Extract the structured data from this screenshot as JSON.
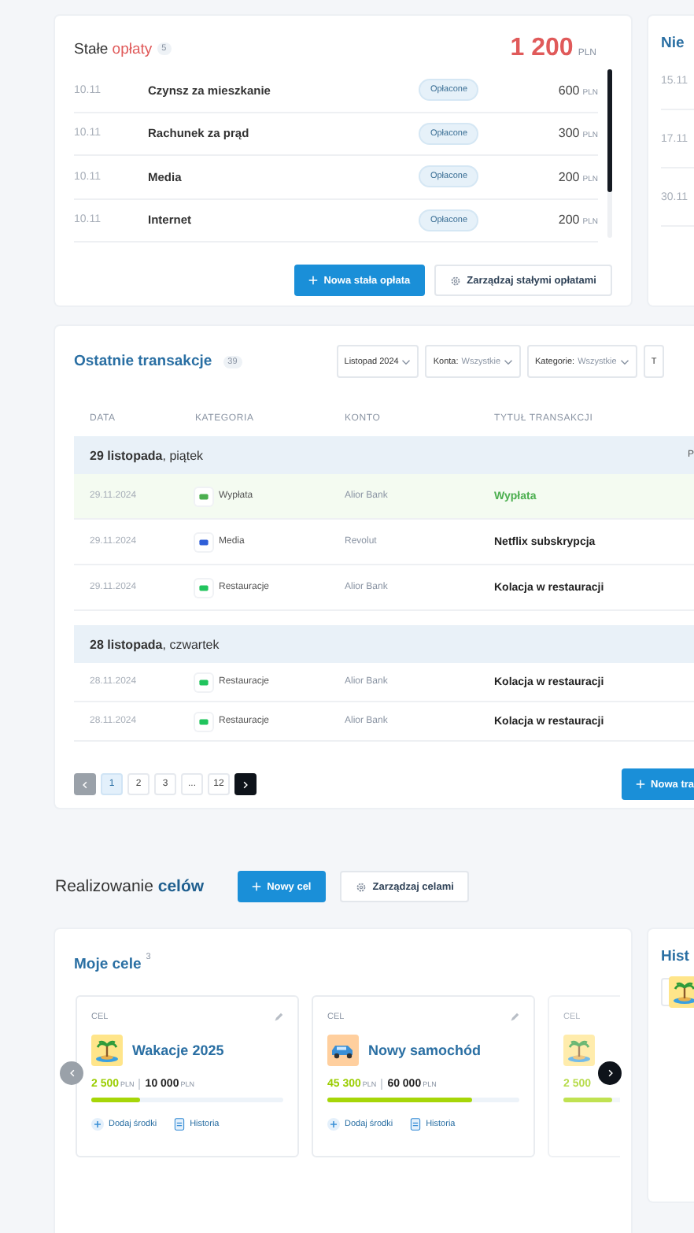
{
  "fixed_fees": {
    "title": "Stałe",
    "title_accent": "opłaty",
    "count": "5",
    "total": "1 200",
    "total_currency": "PLN",
    "rows": [
      {
        "date": "10.11",
        "name": "Czynsz za mieszkanie",
        "status": "Opłacone",
        "amount": "600",
        "currency": "PLN"
      },
      {
        "date": "10.11",
        "name": "Rachunek za prąd",
        "status": "Opłacone",
        "amount": "300",
        "currency": "PLN"
      },
      {
        "date": "10.11",
        "name": "Media",
        "status": "Opłacone",
        "amount": "200",
        "currency": "PLN"
      },
      {
        "date": "10.11",
        "name": "Internet",
        "status": "Opłacone",
        "amount": "200",
        "currency": "PLN"
      }
    ],
    "buttons": [
      {
        "label": "Nowa stała opłata",
        "kind": "primary"
      },
      {
        "label": "Zarządzaj stałymi opłatami",
        "kind": "secondary"
      }
    ]
  },
  "upcoming": {
    "title": "Nie",
    "dates": [
      "15.11",
      "17.11",
      "30.11"
    ]
  },
  "transactions": {
    "title": "Ostatnie transakcje",
    "count": "39",
    "filters": [
      {
        "label": "Listopad 2024",
        "dropdown": true
      },
      {
        "label": "Konta:",
        "value": "Wszystkie",
        "dropdown": true
      },
      {
        "label": "Kategorie:",
        "value": "Wszystkie",
        "dropdown": true
      },
      {
        "label": "T",
        "dropdown": false
      }
    ],
    "columns": [
      "DATA",
      "KATEGORIA",
      "KONTO",
      "TYTUŁ TRANSAKCJI"
    ],
    "groups": [
      {
        "heading": "**29 listopada**, piątek",
        "side": "P",
        "rows": [
          {
            "kind": "income",
            "date": "29.11.2024",
            "category": "Wypłata",
            "color": "#4caf50",
            "account": "Alior Bank",
            "title": "Wypłata"
          },
          {
            "kind": "expense",
            "date": "29.11.2024",
            "category": "Media",
            "color": "#2f5fd8",
            "account": "Revolut",
            "title": "Netflix subskrypcja"
          },
          {
            "kind": "expense",
            "date": "29.11.2024",
            "category": "Restauracje",
            "color": "#21c45d",
            "account": "Alior Bank",
            "title": "Kolacja w restauracji"
          }
        ]
      },
      {
        "heading": "**28 listopada**, czwartek",
        "rows": [
          {
            "kind": "expense",
            "date": "28.11.2024",
            "category": "Restauracje",
            "color": "#21c45d",
            "account": "Alior Bank",
            "title": "Kolacja w restauracji"
          },
          {
            "kind": "expense",
            "date": "28.11.2024",
            "category": "Restauracje",
            "color": "#21c45d",
            "account": "Alior Bank",
            "title": "Kolacja w restauracji"
          }
        ]
      }
    ],
    "pagination": {
      "prev_disabled": true,
      "next_disabled": false,
      "pages": [
        {
          "label": "1",
          "selected": true
        },
        {
          "label": "2",
          "selected": false
        },
        {
          "label": "3",
          "selected": false
        },
        {
          "label": "...",
          "selected": false
        },
        {
          "label": "12",
          "selected": false
        }
      ]
    },
    "new_button": "Nowa tra"
  },
  "goals": {
    "title": "Realizowanie",
    "title_accent": "celów",
    "buttons": [
      {
        "label": "Nowy cel",
        "kind": "primary"
      },
      {
        "label": "Zarządzaj celami",
        "kind": "secondary"
      }
    ],
    "my_goals": {
      "title": "Moje cele",
      "count": "3",
      "cards": [
        {
          "kind": "full",
          "label": "CEL",
          "name": "Wakacje 2025",
          "saved": "2 500",
          "saved_currency": "PLN",
          "target": "10 000",
          "target_currency": "PLN",
          "level": 0.25,
          "actions": [
            "Dodaj środki",
            "Historia"
          ]
        },
        {
          "kind": "full",
          "label": "CEL",
          "name": "Nowy samochód",
          "saved": "45 300",
          "saved_currency": "PLN",
          "target": "60 000",
          "target_currency": "PLN",
          "level": 0.755,
          "actions": [
            "Dodaj środki",
            "Historia"
          ]
        },
        {
          "kind": "partial",
          "label": "CEL",
          "saved": "2 500",
          "level": 0.25
        }
      ]
    },
    "history": {
      "title": "Hist"
    }
  }
}
